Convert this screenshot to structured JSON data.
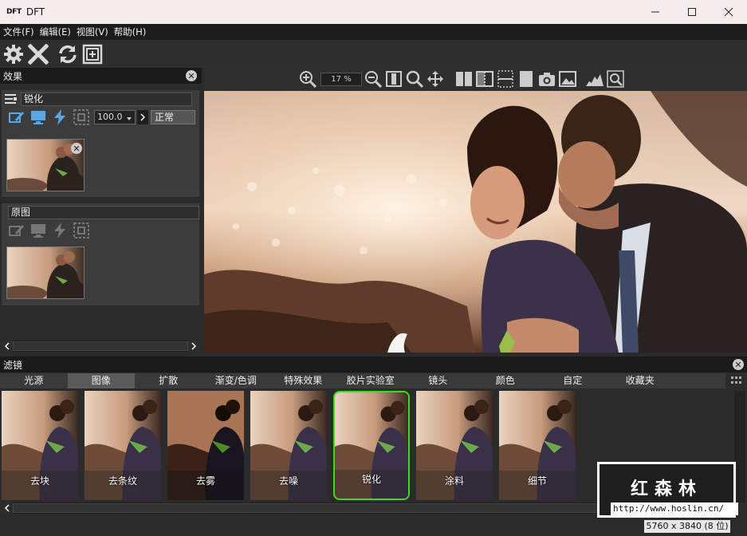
{
  "window": {
    "logo": "DFT",
    "title": "DFT",
    "minimize_icon": "minimize-icon",
    "maximize_icon": "maximize-icon",
    "close_icon": "close-icon"
  },
  "menu": [
    "文件(F)",
    "编辑(E)",
    "视图(V)",
    "帮助(H)"
  ],
  "toolbar": {
    "icons": [
      "gear-icon",
      "close-x-icon",
      "refresh-icon",
      "fit-screen-icon"
    ]
  },
  "effects_panel": {
    "title": "效果",
    "effect_name": "锐化",
    "strength_value": "100.0",
    "blend_mode": "正常",
    "original_label": "原图"
  },
  "viewer": {
    "zoom_value": "17 %"
  },
  "filters_panel": {
    "title": "滤镜",
    "tabs": [
      "光源",
      "图像",
      "扩散",
      "渐变/色调",
      "特殊效果",
      "胶片实验室",
      "镜头",
      "颜色",
      "自定",
      "收藏夹"
    ],
    "active_tab": "图像",
    "items": [
      "去块",
      "去条纹",
      "去雾",
      "去噪",
      "锐化",
      "涂料",
      "细节"
    ],
    "selected_item": "锐化"
  },
  "watermark": {
    "cn_text": "红森林",
    "url": "http://www.hoslin.cn/"
  },
  "status": {
    "image_info": "5760 x 3840 (8 位)"
  },
  "colors": {
    "selection_accent": "#3ddc1f",
    "icon_blue": "#5aa7e6"
  }
}
